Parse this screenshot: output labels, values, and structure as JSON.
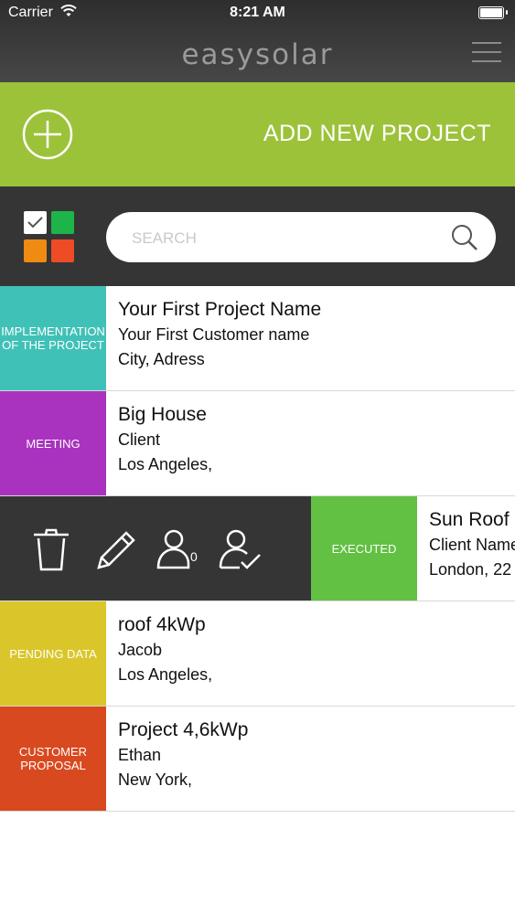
{
  "status_bar": {
    "carrier": "Carrier",
    "time": "8:21 AM"
  },
  "header": {
    "logo": "easysolar"
  },
  "add_project": {
    "label": "ADD NEW PROJECT"
  },
  "search": {
    "placeholder": "SEARCH"
  },
  "filter_colors": [
    "#ffffff",
    "#1db54a",
    "#ef8a13",
    "#ee4b27"
  ],
  "actions": {
    "invite_count": "0"
  },
  "projects": [
    {
      "status": "IMPLEMENTATION OF THE PROJECT",
      "status_color": "#40c1b7",
      "name": "Your First Project Name",
      "customer": "Your First Customer name",
      "address": "City,  Adress"
    },
    {
      "status": "MEETING",
      "status_color": "#a932bf",
      "name": "Big House",
      "customer": "Client",
      "address": "Los Angeles,"
    },
    {
      "status": "EXECUTED",
      "status_color": "#62c043",
      "name": "Sun Roof",
      "customer": "Client Name",
      "address": "London,  22"
    },
    {
      "status": "PENDING DATA",
      "status_color": "#dac62a",
      "name": "roof 4kWp",
      "customer": "Jacob",
      "address": "Los Angeles,"
    },
    {
      "status": "CUSTOMER PROPOSAL",
      "status_color": "#d9491f",
      "name": "Project 4,6kWp",
      "customer": "Ethan",
      "address": "New York,"
    }
  ]
}
